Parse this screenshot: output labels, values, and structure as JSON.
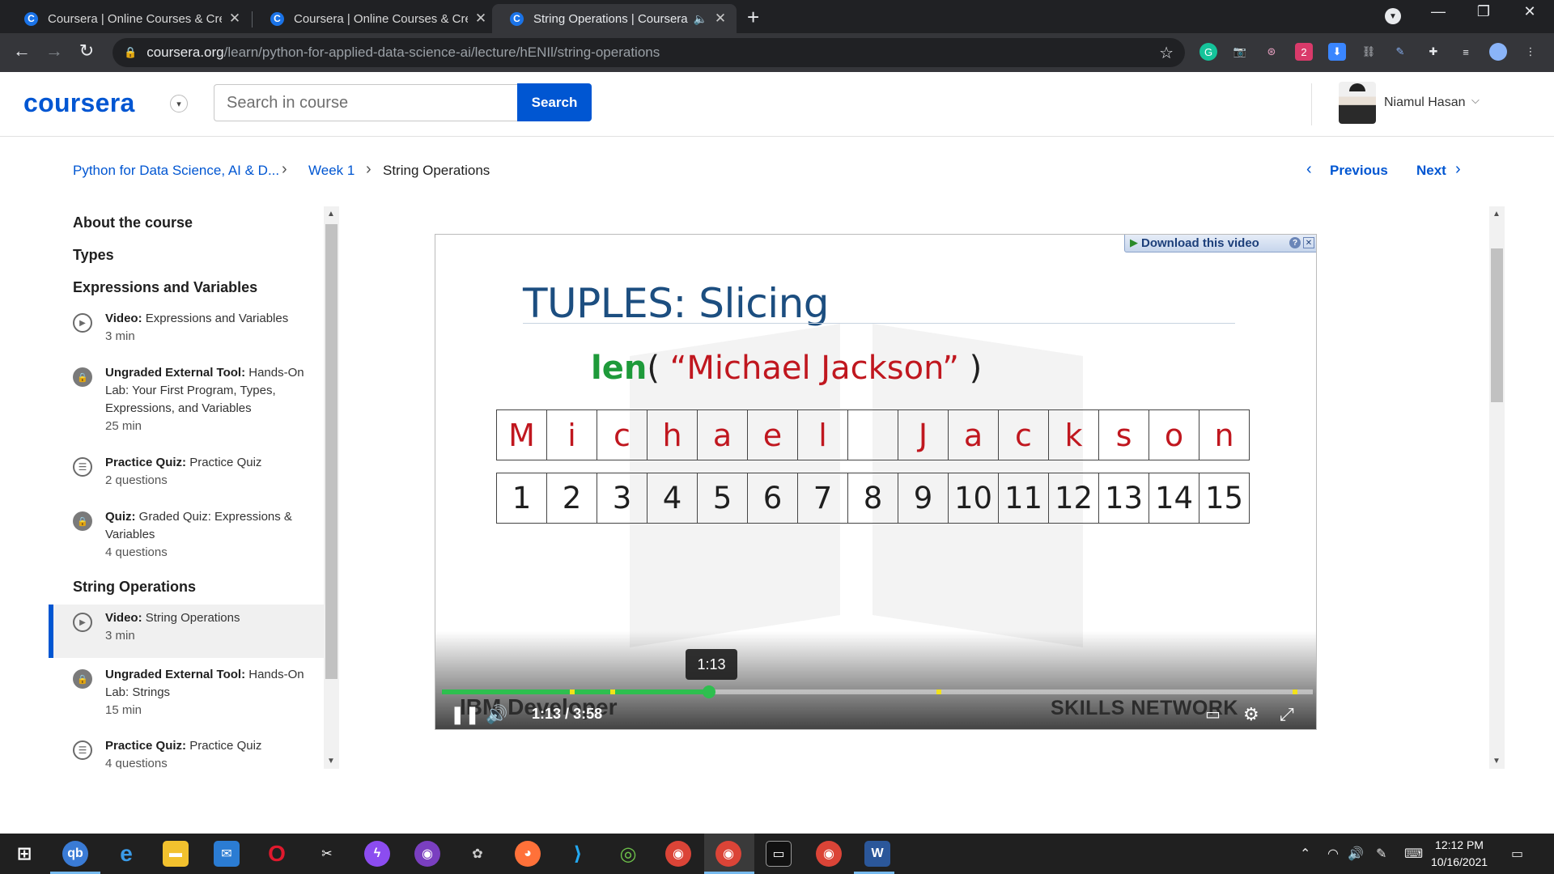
{
  "browser": {
    "tabs": [
      {
        "title": "Coursera | Online Courses & Credentials",
        "favicon": "C",
        "active": false
      },
      {
        "title": "Coursera | Online Courses & Credentials",
        "favicon": "C",
        "active": false
      },
      {
        "title": "String Operations | Coursera",
        "favicon": "C",
        "active": true,
        "audio": true
      }
    ],
    "url_domain": "coursera.org",
    "url_path": "/learn/python-for-applied-data-science-ai/lecture/hENIl/string-operations"
  },
  "header": {
    "logo": "coursera",
    "search_placeholder": "Search in course",
    "search_button": "Search",
    "user_name": "Niamul Hasan"
  },
  "breadcrumb": {
    "course": "Python for Data Science, AI & D...",
    "week": "Week 1",
    "current": "String Operations",
    "previous": "Previous",
    "next": "Next"
  },
  "sidebar": {
    "sections": [
      "About the course",
      "Types",
      "Expressions and Variables",
      "String Operations"
    ],
    "items": [
      {
        "kind": "Video:",
        "title": "Expressions and Variables",
        "meta": "3 min",
        "icon": "play-icon"
      },
      {
        "kind": "Ungraded External Tool:",
        "title": "Hands-On Lab: Your First Program, Types, Expressions, and Variables",
        "meta": "25 min",
        "icon": "lock-icon"
      },
      {
        "kind": "Practice Quiz:",
        "title": "Practice Quiz",
        "meta": "2 questions",
        "icon": "quiz-icon"
      },
      {
        "kind": "Quiz:",
        "title": "Graded Quiz: Expressions & Variables",
        "meta": "4 questions",
        "icon": "lock-icon"
      },
      {
        "kind": "Video:",
        "title": "String Operations",
        "meta": "3 min",
        "icon": "play-icon",
        "active": true
      },
      {
        "kind": "Ungraded External Tool:",
        "title": "Hands-On Lab: Strings",
        "meta": "15 min",
        "icon": "lock-icon"
      },
      {
        "kind": "Practice Quiz:",
        "title": "Practice Quiz",
        "meta": "4 questions",
        "icon": "quiz-icon"
      }
    ]
  },
  "video": {
    "download_banner": "Download this video",
    "slide_title": "TUPLES: Slicing",
    "code_fn": "len",
    "code_open": "( ",
    "code_string": "“Michael Jackson”",
    "code_close": " )",
    "characters": [
      "M",
      "i",
      "c",
      "h",
      "a",
      "e",
      "l",
      " ",
      "J",
      "a",
      "c",
      "k",
      "s",
      "o",
      "n"
    ],
    "indices": [
      "1",
      "2",
      "3",
      "4",
      "5",
      "6",
      "7",
      "8",
      "9",
      "10",
      "11",
      "12",
      "13",
      "14",
      "15"
    ],
    "brand_left": "IBM Developer",
    "brand_right": "SKILLS NETWORK",
    "tooltip": "1:13",
    "current_time": "1:13",
    "time_separator": "/",
    "duration": "3:58",
    "progress_fraction": 0.307,
    "markers_fraction": [
      0.147,
      0.193,
      0.568,
      0.977
    ],
    "accent_color": "#2ebf4f",
    "marker_color": "#f2e21a"
  },
  "taskbar": {
    "time": "12:12 PM",
    "date": "10/16/2021"
  }
}
